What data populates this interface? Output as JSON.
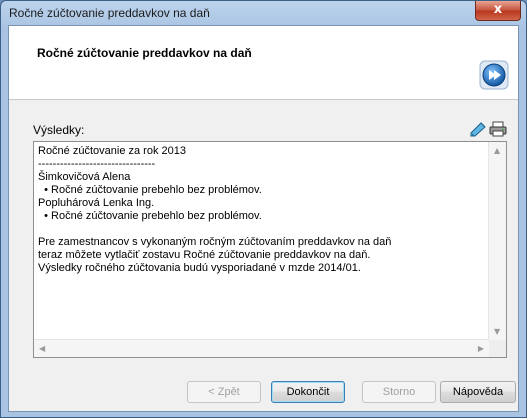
{
  "window": {
    "title": "Ročné zúčtovanie preddavkov na daň",
    "close_label": "x"
  },
  "header": {
    "title": "Ročné zúčtovanie preddavkov na daň",
    "icon": "wizard-forward-icon"
  },
  "results": {
    "label": "Výsledky:",
    "text": "Ročné zúčtovanie za rok 2013\n--------------------------------\nŠimkovičová Alena\n  • Ročné zúčtovanie prebehlo bez problémov.\nPopluhárová Lenka Ing.\n  • Ročné zúčtovanie prebehlo bez problémov.\n\nPre zamestnancov s vykonaným ročným zúčtovaním preddavkov na daň\nteraz môžete vytlačiť zostavu Ročné zúčtovanie preddavkov na daň.\nVýsledky ročného zúčtovania budú vysporiadané v mzde 2014/01.",
    "tools": [
      "edit-note-icon",
      "print-icon"
    ]
  },
  "buttons": {
    "back": "< Zpět",
    "finish": "Dokončit",
    "cancel": "Storno",
    "help": "Nápověda"
  },
  "colors": {
    "accent": "#1f6fb5",
    "close": "#c9452b"
  }
}
